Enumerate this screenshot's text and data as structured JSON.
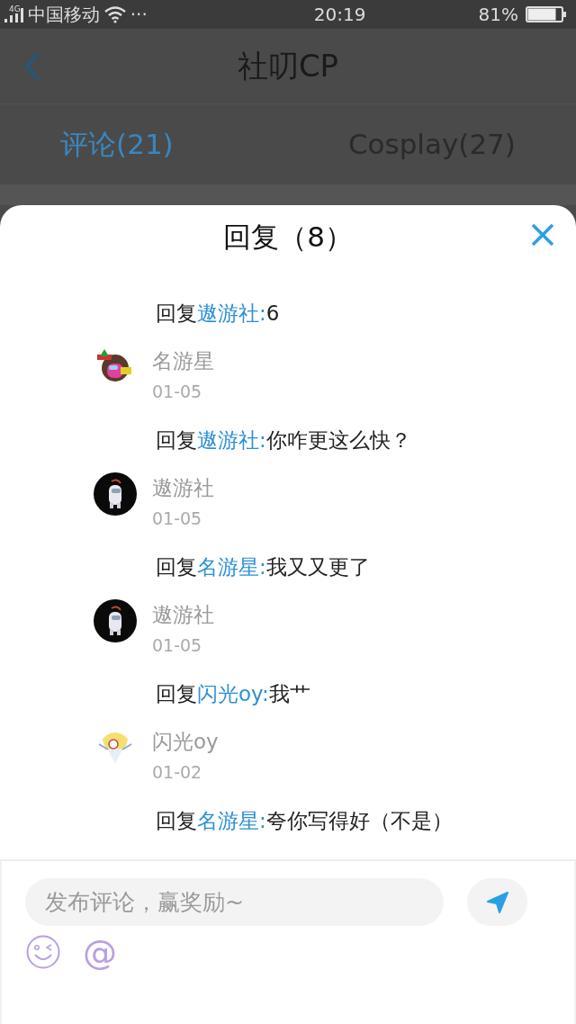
{
  "status_bar": {
    "network": "4G",
    "carrier": "中国移动",
    "more": "···",
    "time": "20:19",
    "battery": "81%"
  },
  "header": {
    "title": "社叨CP"
  },
  "tabs": [
    {
      "label": "评论(21)",
      "selected": true
    },
    {
      "label": "Cosplay(27)",
      "selected": false
    }
  ],
  "sheet": {
    "title": "回复（8）",
    "items": [
      {
        "kind": "reply",
        "prefix": "回复",
        "target": "遨游社:",
        "text": "6"
      },
      {
        "kind": "author",
        "name": "名游星",
        "date": "01-05"
      },
      {
        "kind": "reply",
        "prefix": "回复",
        "target": "遨游社:",
        "text": "你咋更这么快？"
      },
      {
        "kind": "author",
        "name": "遨游社",
        "date": "01-05"
      },
      {
        "kind": "reply",
        "prefix": "回复",
        "target": "名游星:",
        "text": "我又又更了"
      },
      {
        "kind": "author",
        "name": "遨游社",
        "date": "01-05"
      },
      {
        "kind": "reply",
        "prefix": "回复",
        "target": "闪光oy:",
        "text": "我艹"
      },
      {
        "kind": "author",
        "name": "闪光oy",
        "date": "01-02"
      },
      {
        "kind": "reply",
        "prefix": "回复",
        "target": "名游星:",
        "text": "夸你写得好（不是）"
      }
    ]
  },
  "composer": {
    "placeholder": "发布评论，赢奖励~",
    "mention": "@"
  }
}
